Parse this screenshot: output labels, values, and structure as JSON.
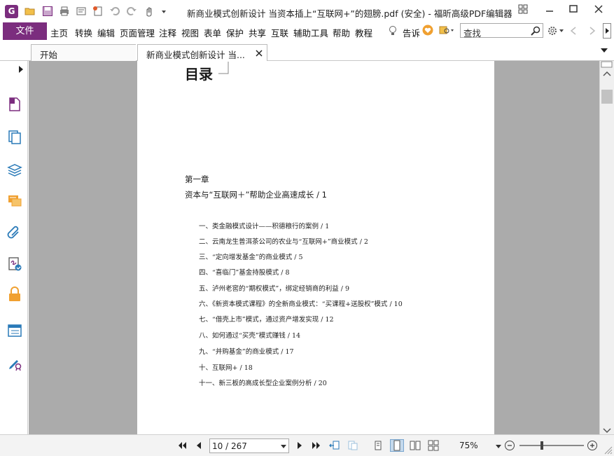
{
  "window": {
    "title": "新商业模式创新设计  当资本插上“互联网+”的翅膀.pdf (安全) - 福昕高级PDF编辑器"
  },
  "menu": {
    "file": "文件",
    "items": [
      "主页",
      "转换",
      "编辑",
      "页面管理",
      "注释",
      "视图",
      "表单",
      "保护",
      "共享",
      "互联",
      "辅助工具",
      "帮助",
      "教程"
    ],
    "tell_me": "告诉",
    "search_placeholder": "查找"
  },
  "tabs": [
    {
      "label": "开始"
    },
    {
      "label": "新商业模式创新设计  当..."
    }
  ],
  "document": {
    "heading": "目录",
    "chapter": "第一章",
    "chapter_title": "资本与“互联网＋”帮助企业高速成长 / 1",
    "toc": [
      "一、类金融模式设计——积德粮行的案例 / 1",
      "二、云南龙生普洱茶公司的农业与“互联网+”商业模式 / 2",
      "三、“定向增发基金”的商业模式 / 5",
      "四、“喜临门”基金持股模式 / 8",
      "五、泸州老窖的“期权模式”，绑定经销商的利益 / 9",
      "六、《新资本模式课程》的全新商业模式：“买课程+送股权”模式 / 10",
      "七、“借壳上市”模式，通过资产增发实现 / 12",
      "八、如何通过“买壳”模式赚钱 / 14",
      "九、“并购基金”的商业模式 / 17",
      "十、互联网+ / 18",
      "十一、新三板的高成长型企业案例分析 / 20"
    ]
  },
  "status": {
    "page": "10 / 267",
    "zoom": "75%"
  },
  "colors": {
    "accent": "#7b2d7e",
    "doc_background": "#ababab"
  }
}
